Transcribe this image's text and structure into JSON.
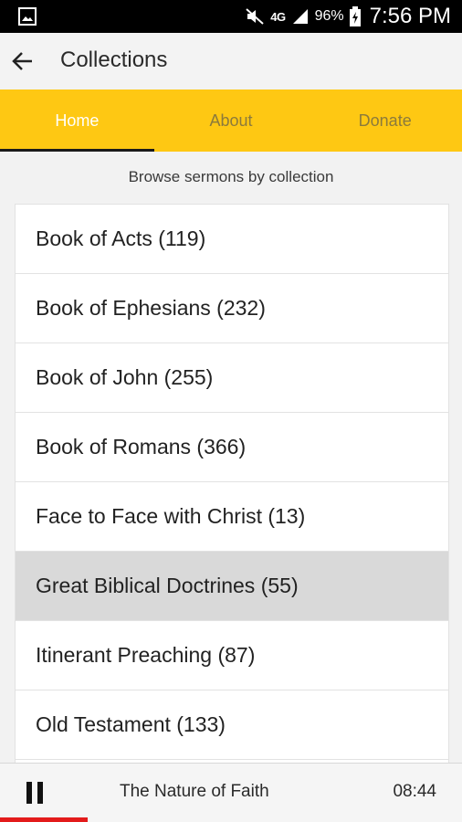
{
  "status_bar": {
    "network": "4G",
    "battery_percent": "96%",
    "time": "7:56 PM",
    "icons": [
      "gallery-icon",
      "mute-icon",
      "signal-icon",
      "battery-icon"
    ]
  },
  "app_bar": {
    "title": "Collections",
    "back_icon": "arrow-left-icon"
  },
  "tabs": [
    {
      "label": "Home",
      "active": true
    },
    {
      "label": "About",
      "active": false
    },
    {
      "label": "Donate",
      "active": false
    }
  ],
  "subtitle": "Browse sermons by collection",
  "collections": [
    {
      "label": "Book of Acts (119)",
      "selected": false
    },
    {
      "label": "Book of Ephesians (232)",
      "selected": false
    },
    {
      "label": "Book of John (255)",
      "selected": false
    },
    {
      "label": "Book of Romans (366)",
      "selected": false
    },
    {
      "label": "Face to Face with Christ (13)",
      "selected": false
    },
    {
      "label": "Great Biblical Doctrines (55)",
      "selected": true
    },
    {
      "label": "Itinerant Preaching (87)",
      "selected": false
    },
    {
      "label": "Old Testament (133)",
      "selected": false
    },
    {
      "label": "",
      "selected": false
    }
  ],
  "player": {
    "title": "The Nature of Faith",
    "time": "08:44",
    "progress": 0.19,
    "pause_icon": "pause-icon"
  },
  "colors": {
    "accent": "#fec813",
    "progress": "#e31b1b",
    "selected_row": "#d9d9d9",
    "status_bar": "#000000"
  }
}
